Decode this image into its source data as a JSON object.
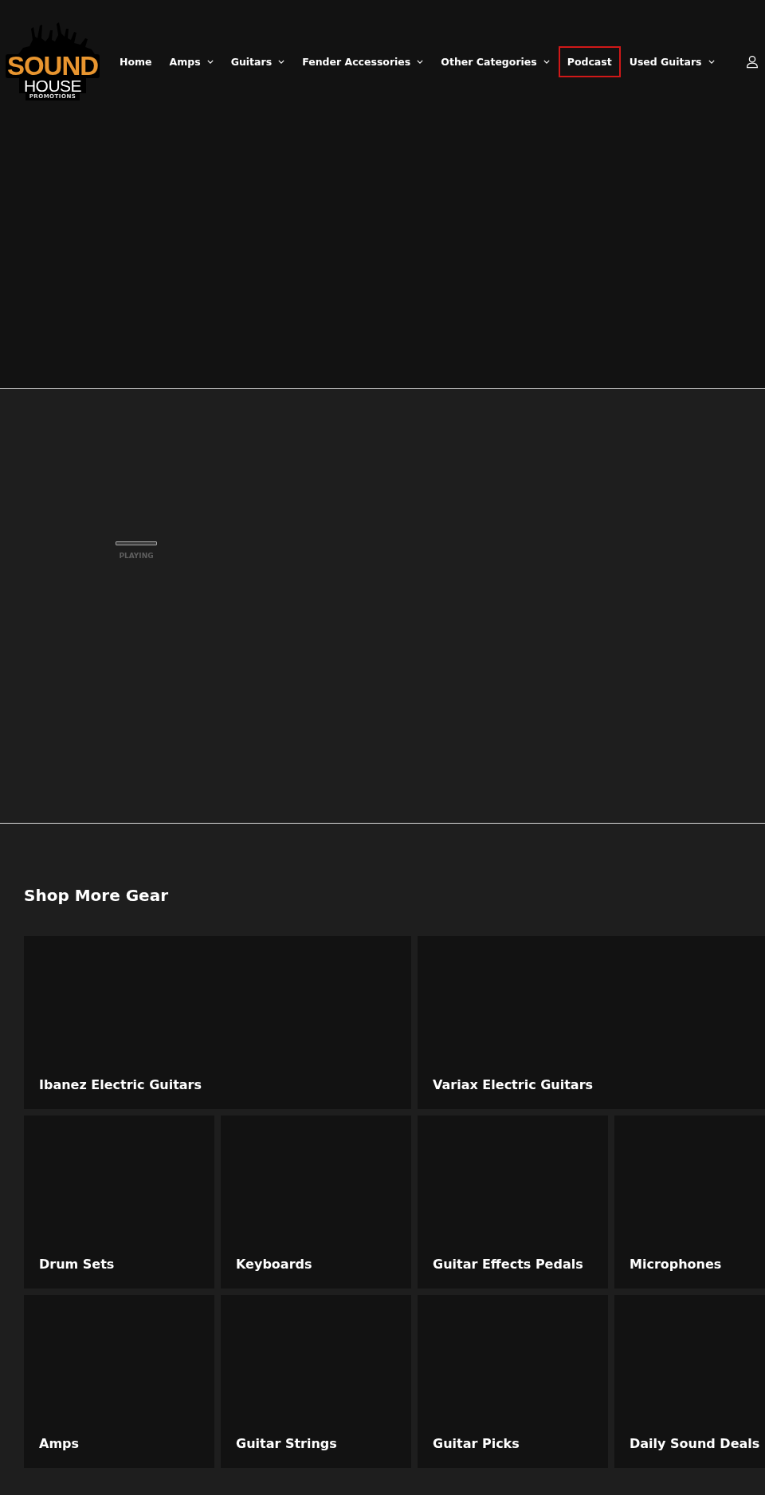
{
  "header": {
    "logo": {
      "wordmark": "SOUND",
      "name": "HOUSE",
      "tagline": "PROMOTIONS"
    },
    "nav": [
      {
        "label": "Home",
        "has_menu": false,
        "focused": false
      },
      {
        "label": "Amps",
        "has_menu": true,
        "focused": false
      },
      {
        "label": "Guitars",
        "has_menu": true,
        "focused": false
      },
      {
        "label": "Fender Accessories",
        "has_menu": true,
        "focused": false
      },
      {
        "label": "Other Categories",
        "has_menu": true,
        "focused": false
      },
      {
        "label": "Podcast",
        "has_menu": false,
        "focused": true
      },
      {
        "label": "Used Guitars",
        "has_menu": true,
        "focused": false
      }
    ]
  },
  "player": {
    "status": "PLAYING"
  },
  "shop_more": {
    "title": "Shop More Gear",
    "collections": [
      {
        "title": "Ibanez Electric Guitars",
        "kind": "wide"
      },
      {
        "title": "Variax Electric Guitars",
        "kind": "wide"
      },
      {
        "title": "Drum Sets",
        "kind": "tile"
      },
      {
        "title": "Keyboards",
        "kind": "tile"
      },
      {
        "title": "Guitar Effects Pedals",
        "kind": "tile"
      },
      {
        "title": "Microphones",
        "kind": "tile"
      },
      {
        "title": "Amps",
        "kind": "tile"
      },
      {
        "title": "Guitar Strings",
        "kind": "tile"
      },
      {
        "title": "Guitar Picks",
        "kind": "tile"
      },
      {
        "title": "Daily Sound Deals",
        "kind": "tile"
      }
    ]
  }
}
